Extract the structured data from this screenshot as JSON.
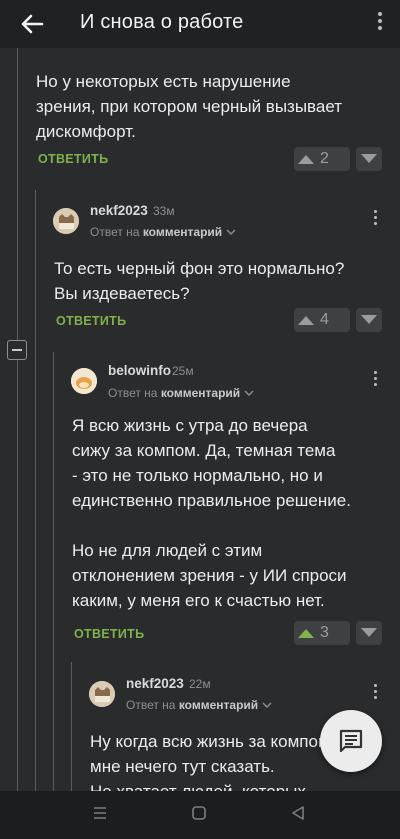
{
  "header": {
    "title": "И снова о работе"
  },
  "icons": {
    "back": "arrow-left-icon",
    "menu": "more-vertical-icon",
    "collapse": "minus-square-icon",
    "fab": "comment-icon",
    "nav_menu": "menu-icon",
    "nav_home": "square-icon",
    "nav_back": "triangle-back-icon"
  },
  "colors": {
    "accent": "#7fb24a",
    "background": "#2a2b2d",
    "topbar": "#202123"
  },
  "comments": [
    {
      "text_lines": [
        "Но у некоторых есть нарушение",
        "зрения, при котором черный вызывает",
        "дискомфорт."
      ],
      "reply_label": "ОТВЕТИТЬ",
      "votes": "2"
    },
    {
      "username": "nekf2023",
      "time": "33м",
      "reply_to_prefix": "Ответ на",
      "reply_to_link": "комментарий",
      "text_lines": [
        "То есть черный фон это нормально?",
        "Вы издеваетесь?"
      ],
      "reply_label": "ОТВЕТИТЬ",
      "votes": "4"
    },
    {
      "username": "belowinfo",
      "time": "25м",
      "reply_to_prefix": "Ответ на",
      "reply_to_link": "комментарий",
      "text_lines": [
        "Я всю жизнь с утра до вечера",
        "сижу за компом. Да, темная тема",
        "- это не только нормально, но и",
        "единственно правильное решение.",
        "",
        "Но не для людей с этим",
        "отклонением зрения - у ИИ спроси",
        "каким, у меня его к счастью нет."
      ],
      "reply_label": "ОТВЕТИТЬ",
      "votes": "3"
    },
    {
      "username": "nekf2023",
      "time": "22м",
      "reply_to_prefix": "Ответ на",
      "reply_to_link": "комментарий",
      "text_lines": [
        "Ну когда всю жизнь за компом",
        "мне нечего тут сказать.",
        "Не хватает людей, которых"
      ]
    }
  ]
}
